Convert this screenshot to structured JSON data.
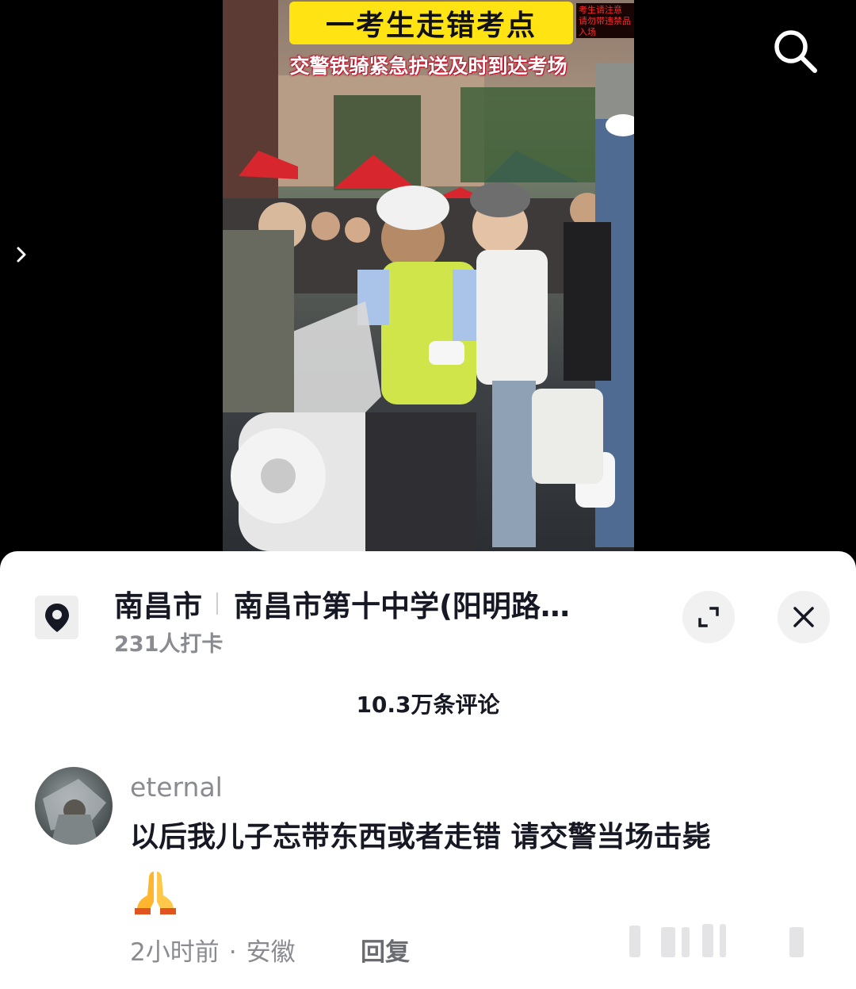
{
  "video": {
    "headline": "一考生走错考点",
    "subtitle": "交警铁骑紧急护送及时到达考场",
    "led_text": "考生请注意 请勿带违禁品入场",
    "icons": {
      "search": "search-icon",
      "expand": "chevron-right-icon"
    }
  },
  "location": {
    "city": "南昌市",
    "place": "南昌市第十中学(阳明路…",
    "checkins": "231人打卡",
    "icon": "location-pin-icon"
  },
  "sheet": {
    "comment_count": "10.3万条评论"
  },
  "comment": {
    "username": "eternal",
    "text": "以后我儿子忘带东西或者走错 请交警当场击毙",
    "emoji": "🙏",
    "time": "2小时前",
    "separator": "·",
    "region": "安徽",
    "reply_label": "回复"
  },
  "colors": {
    "banner_yellow": "#ffe312",
    "subtitle_outline": "#c0142c",
    "text_primary": "#161823",
    "text_secondary": "#8a8b91"
  }
}
